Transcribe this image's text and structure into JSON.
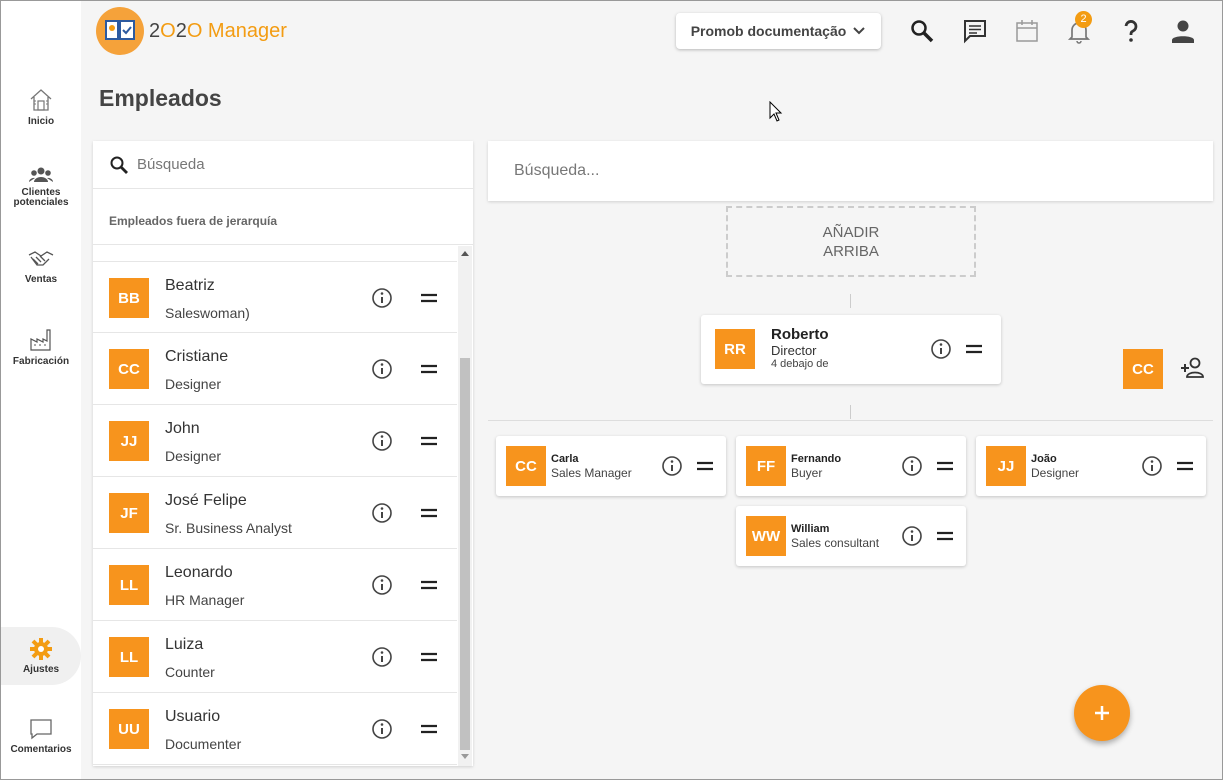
{
  "app": {
    "logo_text_prefix": "2",
    "logo_text_circle": "O",
    "logo_text_num": "2O",
    "logo_text_name": " Manager"
  },
  "header": {
    "doc_button_label": "Promob documentação",
    "notification_count": "2"
  },
  "nav": [
    {
      "label": "Inicio",
      "icon": "home-icon"
    },
    {
      "label": "Clientes potenciales",
      "icon": "people-icon"
    },
    {
      "label": "Ventas",
      "icon": "handshake-icon"
    },
    {
      "label": "Fabricación",
      "icon": "factory-icon"
    },
    {
      "label": "Ajustes",
      "icon": "gear-icon"
    },
    {
      "label": "Comentarios",
      "icon": "comment-icon"
    }
  ],
  "page": {
    "title": "Empleados"
  },
  "left_panel": {
    "search_placeholder": "Búsqueda",
    "subtitle": "Empleados fuera de jerarquía",
    "employees": [
      {
        "initials": "BB",
        "name": "Beatriz",
        "role": "Saleswoman)"
      },
      {
        "initials": "CC",
        "name": "Cristiane",
        "role": "Designer"
      },
      {
        "initials": "JJ",
        "name": "John",
        "role": "Designer"
      },
      {
        "initials": "JF",
        "name": "José Felipe",
        "role": "Sr. Business Analyst"
      },
      {
        "initials": "LL",
        "name": "Leonardo",
        "role": "HR Manager"
      },
      {
        "initials": "LL",
        "name": "Luiza",
        "role": "Counter"
      },
      {
        "initials": "UU",
        "name": "Usuario",
        "role": "Documenter"
      }
    ]
  },
  "right_panel": {
    "search_placeholder": "Búsqueda...",
    "add_above_line1": "AÑADIR",
    "add_above_line2": "ARRIBA",
    "root": {
      "initials": "RR",
      "name": "Roberto",
      "role": "Director",
      "sub": "4 debajo de"
    },
    "children": [
      {
        "initials": "CC",
        "name": "Carla",
        "role": "Sales Manager"
      },
      {
        "initials": "FF",
        "name": "Fernando",
        "role": "Buyer"
      },
      {
        "initials": "JJ",
        "name": "João",
        "role": "Designer"
      },
      {
        "initials": "WW",
        "name": "William",
        "role": "Sales consultant"
      }
    ],
    "side_avatar": "CC"
  },
  "colors": {
    "accent": "#f7941d"
  }
}
